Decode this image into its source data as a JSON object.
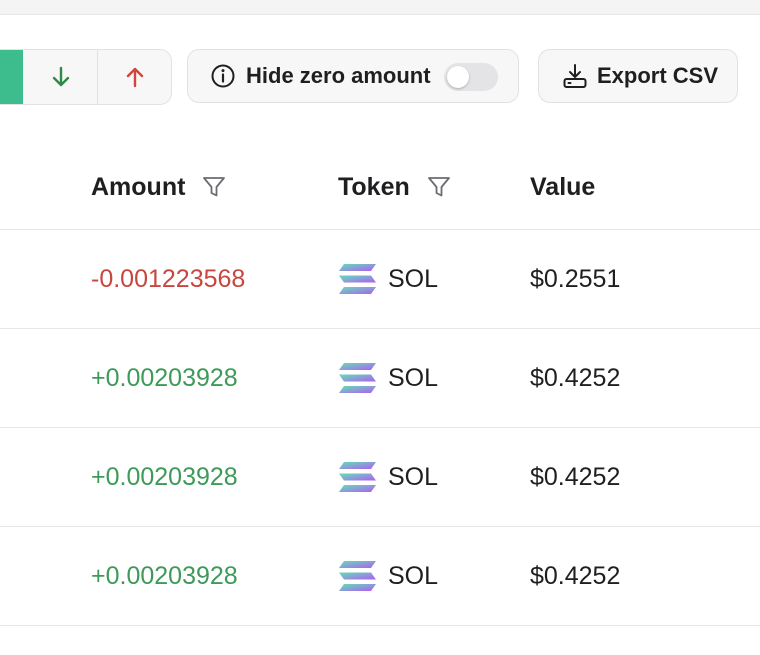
{
  "toolbar": {
    "direction_filter": {
      "selected_color": "#3dbd8e",
      "incoming_icon": "arrow-down-icon",
      "outgoing_icon": "arrow-up-icon"
    },
    "hide_zero": {
      "icon": "info-circle-icon",
      "label": "Hide zero amount",
      "enabled": false
    },
    "export": {
      "icon": "download-tray-icon",
      "label": "Export CSV"
    }
  },
  "table": {
    "columns": [
      {
        "label": "Amount",
        "filter_icon": "filter-icon"
      },
      {
        "label": "Token",
        "filter_icon": "filter-icon"
      },
      {
        "label": "Value"
      }
    ],
    "rows": [
      {
        "amount": "-0.001223568",
        "direction": "negative",
        "token": "SOL",
        "value": "$0.2551"
      },
      {
        "amount": "+0.00203928",
        "direction": "positive",
        "token": "SOL",
        "value": "$0.4252"
      },
      {
        "amount": "+0.00203928",
        "direction": "positive",
        "token": "SOL",
        "value": "$0.4252"
      },
      {
        "amount": "+0.00203928",
        "direction": "positive",
        "token": "SOL",
        "value": "$0.4252"
      }
    ]
  },
  "colors": {
    "negative": "#c8463f",
    "positive": "#3d9a58",
    "arrow_down": "#2f8a45",
    "arrow_up": "#d0453c"
  }
}
